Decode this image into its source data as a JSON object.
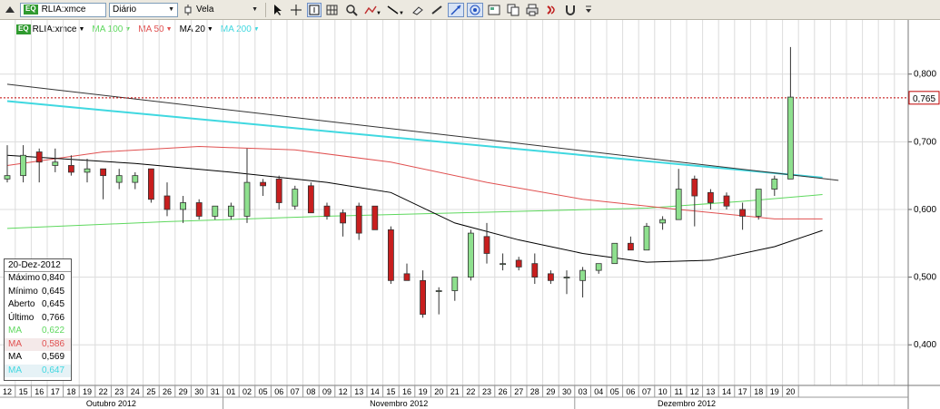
{
  "toolbar": {
    "symbol": "RLIA:xmce",
    "symbol_badge": "EQ",
    "period": "Diário",
    "chart_style": "Vela",
    "icons": [
      "scroll-up-icon",
      "cursor-icon",
      "crosshair-icon",
      "info-box-icon",
      "grid-icon",
      "zoom-icon",
      "indicator-icon",
      "trendline-icon",
      "eraser-icon",
      "auto-scale-icon",
      "style-icon",
      "template-icon",
      "print-icon",
      "copy-icon",
      "sound-icon",
      "magnet-icon",
      "menu-more-icon"
    ]
  },
  "legend": [
    {
      "label": "RLIA:xmce",
      "color": "#000000",
      "badge": "EQ"
    },
    {
      "label": "MA 100",
      "color": "#5ed85e"
    },
    {
      "label": "MA 50",
      "color": "#e05050"
    },
    {
      "label": "MA 20",
      "color": "#000000"
    },
    {
      "label": "MA 200",
      "color": "#3fd8e0"
    }
  ],
  "info_box": {
    "date": "20-Dez-2012",
    "rows": [
      {
        "k": "Máximo",
        "v": "0,840",
        "color": "#000000",
        "bg": ""
      },
      {
        "k": "Mínimo",
        "v": "0,645",
        "color": "#000000",
        "bg": ""
      },
      {
        "k": "Aberto",
        "v": "0,645",
        "color": "#000000",
        "bg": ""
      },
      {
        "k": "Último",
        "v": "0,766",
        "color": "#000000",
        "bg": ""
      },
      {
        "k": "MA",
        "v": "0,622",
        "color": "#5ed85e",
        "bg": ""
      },
      {
        "k": "MA",
        "v": "0,586",
        "color": "#e05050",
        "bg": "#f4e9e9"
      },
      {
        "k": "MA",
        "v": "0,569",
        "color": "#000000",
        "bg": ""
      },
      {
        "k": "MA",
        "v": "0,647",
        "color": "#3fd8e0",
        "bg": "#e6f2f6"
      }
    ]
  },
  "chart_data": {
    "type": "candlestick",
    "x_ticks": [
      "12",
      "15",
      "16",
      "17",
      "18",
      "19",
      "22",
      "23",
      "24",
      "25",
      "26",
      "29",
      "30",
      "31",
      "01",
      "02",
      "05",
      "06",
      "07",
      "08",
      "09",
      "12",
      "13",
      "14",
      "15",
      "16",
      "19",
      "20",
      "21",
      "22",
      "23",
      "26",
      "27",
      "28",
      "29",
      "30",
      "03",
      "04",
      "05",
      "06",
      "07",
      "10",
      "11",
      "12",
      "13",
      "14",
      "17",
      "18",
      "19",
      "20"
    ],
    "months": [
      {
        "label": "Outubro 2012",
        "start": 0,
        "end": 13
      },
      {
        "label": "Novembro 2012",
        "start": 14,
        "end": 35
      },
      {
        "label": "Dezembro 2012",
        "start": 36,
        "end": 49
      }
    ],
    "y_ticks": [
      "0,400",
      "0,500",
      "0,600",
      "0,700",
      "0,800"
    ],
    "ylim": [
      0.34,
      0.88
    ],
    "last_price_label": "0,765",
    "last_price": 0.765,
    "candles": [
      {
        "o": 0.615,
        "h": 0.64,
        "l": 0.6,
        "c": 0.63
      },
      {
        "o": 0.645,
        "h": 0.66,
        "l": 0.61,
        "c": 0.615
      },
      {
        "o": 0.66,
        "h": 0.685,
        "l": 0.635,
        "c": 0.645
      },
      {
        "o": 0.645,
        "h": 0.695,
        "l": 0.64,
        "c": 0.65
      },
      {
        "o": 0.65,
        "h": 0.695,
        "l": 0.64,
        "c": 0.68
      },
      {
        "o": 0.685,
        "h": 0.69,
        "l": 0.64,
        "c": 0.67
      },
      {
        "o": 0.665,
        "h": 0.69,
        "l": 0.655,
        "c": 0.67
      },
      {
        "o": 0.665,
        "h": 0.68,
        "l": 0.65,
        "c": 0.655
      },
      {
        "o": 0.655,
        "h": 0.675,
        "l": 0.64,
        "c": 0.66
      },
      {
        "o": 0.66,
        "h": 0.66,
        "l": 0.615,
        "c": 0.65
      },
      {
        "o": 0.64,
        "h": 0.66,
        "l": 0.63,
        "c": 0.65
      },
      {
        "o": 0.64,
        "h": 0.655,
        "l": 0.63,
        "c": 0.65
      },
      {
        "o": 0.66,
        "h": 0.66,
        "l": 0.61,
        "c": 0.615
      },
      {
        "o": 0.62,
        "h": 0.64,
        "l": 0.59,
        "c": 0.6
      },
      {
        "o": 0.6,
        "h": 0.62,
        "l": 0.58,
        "c": 0.61
      },
      {
        "o": 0.61,
        "h": 0.615,
        "l": 0.585,
        "c": 0.59
      },
      {
        "o": 0.59,
        "h": 0.605,
        "l": 0.585,
        "c": 0.605
      },
      {
        "o": 0.59,
        "h": 0.61,
        "l": 0.585,
        "c": 0.605
      },
      {
        "o": 0.59,
        "h": 0.69,
        "l": 0.58,
        "c": 0.64
      },
      {
        "o": 0.64,
        "h": 0.645,
        "l": 0.62,
        "c": 0.635
      },
      {
        "o": 0.645,
        "h": 0.65,
        "l": 0.6,
        "c": 0.61
      },
      {
        "o": 0.605,
        "h": 0.635,
        "l": 0.6,
        "c": 0.63
      },
      {
        "o": 0.635,
        "h": 0.64,
        "l": 0.6,
        "c": 0.595
      },
      {
        "o": 0.605,
        "h": 0.61,
        "l": 0.585,
        "c": 0.59
      },
      {
        "o": 0.595,
        "h": 0.6,
        "l": 0.56,
        "c": 0.58
      },
      {
        "o": 0.605,
        "h": 0.61,
        "l": 0.555,
        "c": 0.565
      },
      {
        "o": 0.605,
        "h": 0.605,
        "l": 0.57,
        "c": 0.57
      },
      {
        "o": 0.57,
        "h": 0.575,
        "l": 0.49,
        "c": 0.495
      },
      {
        "o": 0.505,
        "h": 0.52,
        "l": 0.5,
        "c": 0.495
      },
      {
        "o": 0.495,
        "h": 0.51,
        "l": 0.44,
        "c": 0.445
      },
      {
        "o": 0.48,
        "h": 0.485,
        "l": 0.445,
        "c": 0.48
      },
      {
        "o": 0.48,
        "h": 0.5,
        "l": 0.465,
        "c": 0.5
      },
      {
        "o": 0.5,
        "h": 0.57,
        "l": 0.495,
        "c": 0.565
      },
      {
        "o": 0.56,
        "h": 0.58,
        "l": 0.52,
        "c": 0.535
      },
      {
        "o": 0.52,
        "h": 0.535,
        "l": 0.51,
        "c": 0.52
      },
      {
        "o": 0.525,
        "h": 0.53,
        "l": 0.51,
        "c": 0.515
      },
      {
        "o": 0.52,
        "h": 0.535,
        "l": 0.49,
        "c": 0.5
      },
      {
        "o": 0.505,
        "h": 0.51,
        "l": 0.49,
        "c": 0.495
      },
      {
        "o": 0.5,
        "h": 0.51,
        "l": 0.475,
        "c": 0.5
      },
      {
        "o": 0.495,
        "h": 0.515,
        "l": 0.47,
        "c": 0.51
      },
      {
        "o": 0.51,
        "h": 0.52,
        "l": 0.505,
        "c": 0.52
      },
      {
        "o": 0.52,
        "h": 0.55,
        "l": 0.52,
        "c": 0.55
      },
      {
        "o": 0.55,
        "h": 0.56,
        "l": 0.54,
        "c": 0.54
      },
      {
        "o": 0.54,
        "h": 0.58,
        "l": 0.54,
        "c": 0.575
      },
      {
        "o": 0.58,
        "h": 0.59,
        "l": 0.57,
        "c": 0.585
      },
      {
        "o": 0.585,
        "h": 0.66,
        "l": 0.585,
        "c": 0.63
      },
      {
        "o": 0.645,
        "h": 0.65,
        "l": 0.575,
        "c": 0.62
      },
      {
        "o": 0.625,
        "h": 0.63,
        "l": 0.6,
        "c": 0.61
      },
      {
        "o": 0.62,
        "h": 0.625,
        "l": 0.6,
        "c": 0.605
      },
      {
        "o": 0.6,
        "h": 0.61,
        "l": 0.57,
        "c": 0.59
      },
      {
        "o": 0.59,
        "h": 0.63,
        "l": 0.585,
        "c": 0.63
      },
      {
        "o": 0.63,
        "h": 0.65,
        "l": 0.62,
        "c": 0.645
      },
      {
        "o": 0.645,
        "h": 0.84,
        "l": 0.645,
        "c": 0.766
      }
    ],
    "ma_series": [
      {
        "name": "MA 100",
        "color": "#5ed85e",
        "points": [
          [
            0,
            0.572
          ],
          [
            10,
            0.582
          ],
          [
            20,
            0.59
          ],
          [
            30,
            0.596
          ],
          [
            40,
            0.602
          ],
          [
            46,
            0.612
          ],
          [
            51,
            0.622
          ]
        ]
      },
      {
        "name": "MA 50",
        "color": "#e05050",
        "points": [
          [
            0,
            0.665
          ],
          [
            6,
            0.685
          ],
          [
            12,
            0.693
          ],
          [
            18,
            0.688
          ],
          [
            24,
            0.67
          ],
          [
            30,
            0.64
          ],
          [
            36,
            0.615
          ],
          [
            42,
            0.6
          ],
          [
            48,
            0.586
          ],
          [
            51,
            0.586
          ]
        ]
      },
      {
        "name": "MA 20",
        "color": "#000000",
        "points": [
          [
            0,
            0.68
          ],
          [
            8,
            0.668
          ],
          [
            14,
            0.655
          ],
          [
            20,
            0.64
          ],
          [
            24,
            0.625
          ],
          [
            28,
            0.58
          ],
          [
            32,
            0.555
          ],
          [
            36,
            0.535
          ],
          [
            40,
            0.522
          ],
          [
            44,
            0.525
          ],
          [
            48,
            0.545
          ],
          [
            51,
            0.569
          ]
        ]
      },
      {
        "name": "MA 200",
        "color": "#3fd8e0",
        "points": [
          [
            0,
            0.76
          ],
          [
            51,
            0.647
          ]
        ]
      },
      {
        "name": "",
        "color": "#333333",
        "points": [
          [
            0,
            0.785
          ],
          [
            52,
            0.643
          ]
        ]
      }
    ]
  }
}
